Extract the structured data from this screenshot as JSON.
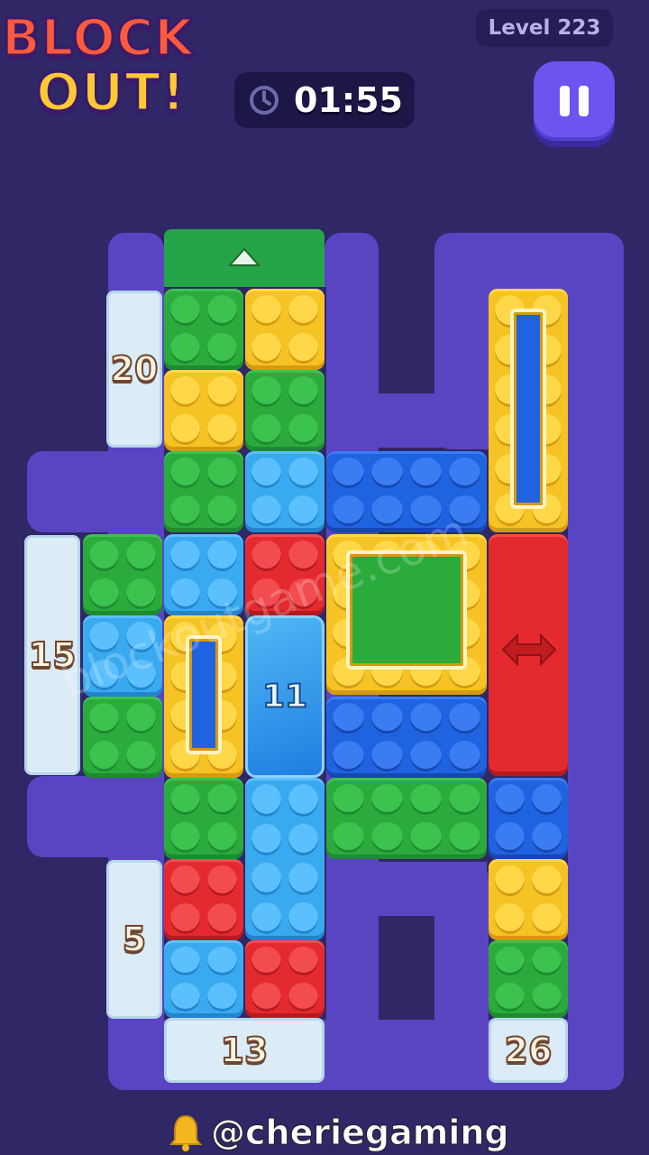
{
  "game": {
    "logo_line1": "BLOCK",
    "logo_line2": "OUT!",
    "level_label": "Level 223",
    "timer": "01:55"
  },
  "board": {
    "blocks": [
      {
        "name": "green-block-a",
        "color": "green"
      },
      {
        "name": "yellow-block-a",
        "color": "yellow"
      },
      {
        "name": "yellow-block-b",
        "color": "yellow"
      },
      {
        "name": "green-block-b",
        "color": "green"
      },
      {
        "name": "green-block-c",
        "color": "green"
      },
      {
        "name": "lightblue-block-a",
        "color": "light-blue"
      },
      {
        "name": "blue-horizontal-block-top",
        "color": "blue"
      },
      {
        "name": "yellow-frame-block-right",
        "color": "yellow"
      },
      {
        "name": "green-block-d",
        "color": "green"
      },
      {
        "name": "lightblue-block-b",
        "color": "light-blue"
      },
      {
        "name": "red-block-a",
        "color": "red"
      },
      {
        "name": "yellow-frame-block-big",
        "color": "yellow"
      },
      {
        "name": "red-vertical-block-arrow",
        "color": "red"
      },
      {
        "name": "lightblue-block-c",
        "color": "light-blue"
      },
      {
        "name": "yellow-frame-block-left",
        "color": "yellow"
      },
      {
        "name": "green-block-e",
        "color": "green"
      },
      {
        "name": "blue-horizontal-block-mid",
        "color": "blue"
      },
      {
        "name": "green-block-f",
        "color": "green"
      },
      {
        "name": "lightblue-vertical-block",
        "color": "light-blue"
      },
      {
        "name": "green-horizontal-block",
        "color": "green"
      },
      {
        "name": "blue-block-right",
        "color": "blue"
      },
      {
        "name": "red-block-b",
        "color": "red"
      },
      {
        "name": "yellow-block-c",
        "color": "yellow"
      },
      {
        "name": "lightblue-block-d",
        "color": "light-blue"
      },
      {
        "name": "red-block-c",
        "color": "red"
      },
      {
        "name": "green-block-g",
        "color": "green"
      }
    ],
    "ice_counters": {
      "left_top": "20",
      "left_mid": "15",
      "left_bottom": "5",
      "bottom_mid": "13",
      "bottom_right": "26"
    },
    "gem_counter": "11"
  },
  "watermark": "blockoutgame.com",
  "credit": "@cheriegaming",
  "icons": {
    "clock": "clock-icon",
    "pause": "pause-icon",
    "bell": "bell-icon",
    "exit_arrow": "up-arrow-icon",
    "double_arrow": "double-arrow-icon"
  },
  "colors": {
    "background": "#2f2766",
    "wall": "#5945c2",
    "green": "#2bab3c",
    "yellow": "#f6c325",
    "light_blue": "#3aaaf0",
    "blue": "#1f63e0",
    "red": "#e52a2f",
    "ice": "#dcecf6",
    "pause_button": "#6c54ef"
  }
}
